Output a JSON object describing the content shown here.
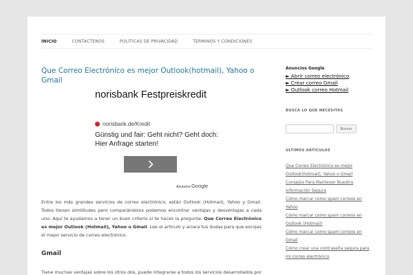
{
  "nav": {
    "items": [
      "INICIO",
      "CONTACTENOS",
      "POLÍTICAS DE PRIVACIDAD",
      "TERMINOS Y CONDICIONES"
    ]
  },
  "post": {
    "title": "Que Correo Electrónico es mejor Outlook(hotmail), Yahoo o Gmail",
    "intro_1": "Entre los más grandes servicios de correo electrónico, están Outlook (Hotmail), Yahoo y Gmail. Todos tienen similitudes pero comparándolos podemos encontrar ventajas y desventajas a cada uno. Aquí te ayudamos a tener un buen criterio si te haces la pregunta: ",
    "intro_bold": "Que Correo Electrónico es mejor Outlook (Hotmail), Yahoo o Gmail",
    "intro_2": ". Lee el artículo y aclara tus dudas para que escojas el mejor servicio de correo electrónico.",
    "h_gmail": "Gmail",
    "gmail_text": "Tiene muchas ventajas sobre los otros dos, puede integrarse a todos los servicios desarrollados por Google como el conocido YouTube donde está la mayor parte de videos subidos a internet."
  },
  "ad": {
    "title": "norisbank Festpreiskredit",
    "url": "norisbank.de/Kredit",
    "text": "Günstig und fair: Geht nicht? Geht doch: Hier Anfrage starten!",
    "attrib_small": "Anuncios",
    "attrib_brand": "Google"
  },
  "sidebar": {
    "ads_head": "Anuncios Google",
    "ad_links": [
      "► Abrir correo electrónico",
      "► Crear correo Gmail",
      "► Outlook correo Hotmail"
    ],
    "search_title": "BUSCA LO QUE NECESITAS",
    "search_button": "Buscar",
    "recent_title": "ULTIMOS ARTICULOS",
    "recent": [
      "Que Correo Electrónico es mejor Outlook(hotmail), Yahoo o Gmail",
      "Consejos Para Mantener Nuestra Información Segura",
      "Cómo marcar como spam correos en Yahoo",
      "Cómo marcar como spam correos en Outlook (Hotmail)",
      "Cómo marcar como spam correos en Gmail",
      "Cómo crear una contraseña segura para mi correo electrónico"
    ]
  }
}
